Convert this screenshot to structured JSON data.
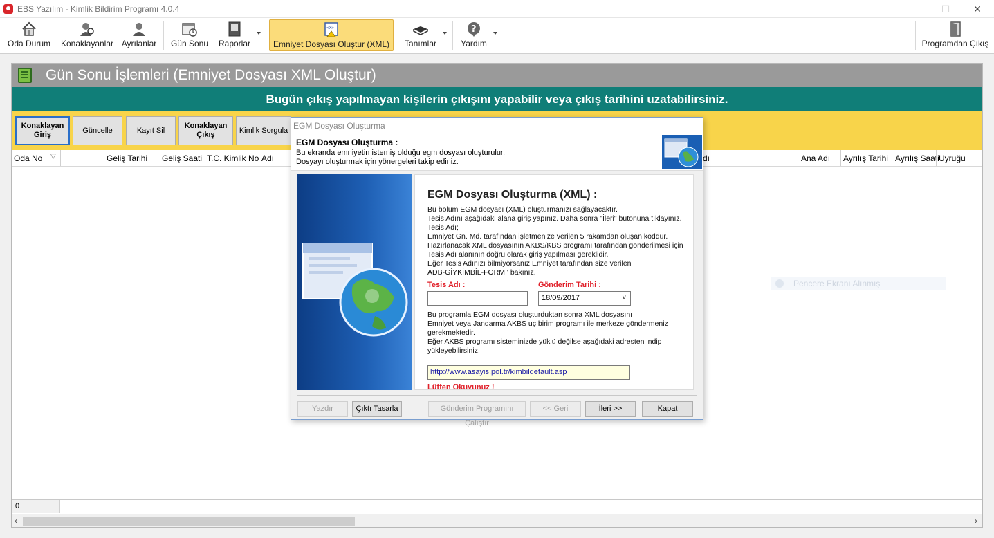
{
  "window": {
    "title": "EBS Yazılım - Kimlik Bildirim Programı 4.0.4",
    "minimize": "—",
    "maximize": "☐",
    "close": "✕"
  },
  "toolbar": {
    "items": [
      {
        "label": "Oda Durum",
        "icon": "home-icon"
      },
      {
        "label": "Konaklayanlar",
        "icon": "guests-icon"
      },
      {
        "label": "Ayrılanlar",
        "icon": "departed-icon"
      },
      {
        "label": "Gün Sonu",
        "icon": "calendar-clock-icon"
      },
      {
        "label": "Raporlar",
        "icon": "reports-icon"
      },
      {
        "label": "Emniyet Dosyası Oluştur (XML)",
        "icon": "xml-file-icon"
      },
      {
        "label": "Tanımlar",
        "icon": "book-icon"
      },
      {
        "label": "Yardım",
        "icon": "help-icon"
      },
      {
        "label": "Programdan Çıkış",
        "icon": "exit-door-icon"
      }
    ]
  },
  "main": {
    "title": "Gün Sonu İşlemleri (Emniyet Dosyası XML Oluştur)",
    "banner": "Bugün çıkış yapılmayan kişilerin çıkışını yapabilir veya çıkış tarihini uzatabilirsiniz.",
    "actions": {
      "konaklayan_giris": "Konaklayan Giriş",
      "guncelle": "Güncelle",
      "kayit_sil": "Kayıt Sil",
      "konaklayan_cikis": "Konaklayan Çıkış",
      "kimlik_sorgula": "Kimlik Sorgula"
    },
    "columns": {
      "oda_no": "Oda No",
      "gelis_tarihi": "Geliş Tarihi",
      "gelis_saati": "Geliş Saati",
      "tc_kimlik": "T.C. Kimlik No",
      "adi": "Adı",
      "soyadi_partial": "dı",
      "ana_adi": "Ana Adı",
      "ayrilis_tarihi": "Ayrılış Tarihi",
      "ayrilis_saati": "Ayrılış Saati",
      "uyrugu": "Uyruğu"
    },
    "watermark": "Pencere Ekranı Alınmış",
    "status_count": "0"
  },
  "dialog": {
    "window_title": "EGM Dosyası Oluşturma",
    "header_title": "EGM Dosyası Oluşturma :",
    "header_line1": "Bu ekranda emniyetin istemiş olduğu egm dosyası oluşturulur.",
    "header_line2": "Dosyayı oluşturmak için yönergeleri takip ediniz.",
    "content_title": "EGM Dosyası Oluşturma (XML) :",
    "para1": [
      "Bu bölüm EGM dosyası (XML) oluşturmanızı sağlayacaktır.",
      "Tesis Adını aşağıdaki alana giriş yapınız. Daha sonra \"İleri\" butonuna tıklayınız.",
      "Tesis Adı;",
      "Emniyet Gn. Md. tarafından işletmenize verilen 5 rakamdan oluşan koddur.",
      "Hazırlanacak XML dosyasının AKBS/KBS programı tarafından gönderilmesi için",
      "Tesis Adı  alanının doğru olarak giriş yapılması gereklidir.",
      "Eğer Tesis Adınızı bilmiyorsanız Emniyet tarafından size verilen",
      "ADB-GİYKİMBİL-FORM ' bakınız."
    ],
    "tesis_adi_label": "Tesis Adı :",
    "tesis_adi_value": "",
    "gonderim_label": "Gönderim Tarihi :",
    "gonderim_value": "18/09/2017",
    "para2": [
      "Bu programla EGM dosyası oluşturduktan sonra  XML dosyasını",
      "Emniyet veya Jandarma AKBS uç birim programı ile merkeze göndermeniz",
      "gerekmektedir.",
      "Eğer AKBS programı sisteminizde yüklü değilse aşağıdaki adresten indip",
      "yükleyebilirsiniz."
    ],
    "link": "http://www.asayis.pol.tr/kimbildefault.asp",
    "cut_text": "Lütfen Okuyunuz !",
    "buttons": {
      "yazdir": "Yazdır",
      "cikti_tasarla": "Çıktı Tasarla",
      "gonderim_calistir": "Gönderim Programını Çalıştır",
      "geri": "<< Geri",
      "ileri": "İleri >>",
      "kapat": "Kapat"
    }
  },
  "colors": {
    "header_gray": "#9a9a9a",
    "banner_teal": "#107e78",
    "action_yellow": "#f8d44a",
    "active_tool": "#fbdc7a",
    "red_label": "#e0202a"
  }
}
